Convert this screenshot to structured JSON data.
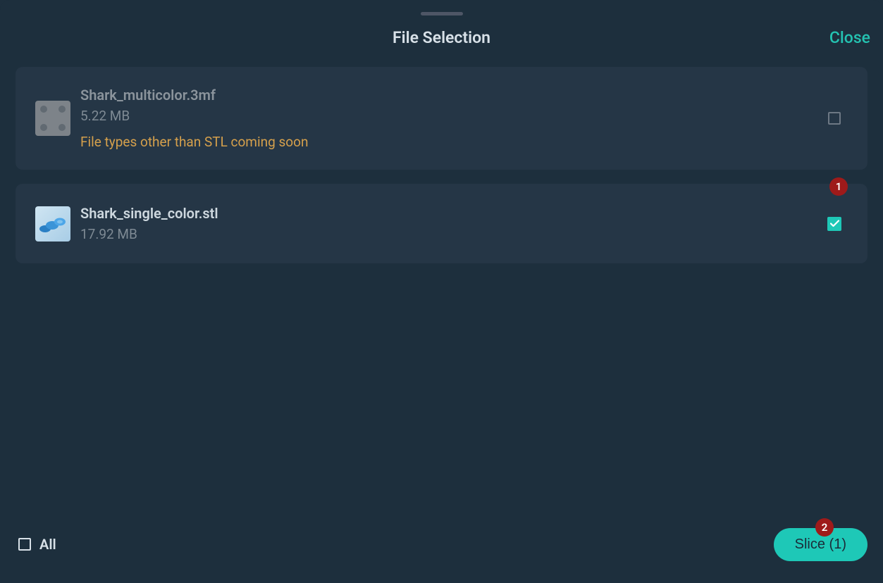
{
  "header": {
    "title": "File Selection",
    "close": "Close"
  },
  "files": [
    {
      "name": "Shark_multicolor.3mf",
      "size": "5.22 MB",
      "warning": "File types other than STL coming soon",
      "selected": false,
      "disabled": true
    },
    {
      "name": "Shark_single_color.stl",
      "size": "17.92 MB",
      "selected": true,
      "disabled": false
    }
  ],
  "badges": {
    "row1": "1",
    "slice": "2"
  },
  "footer": {
    "all": "All",
    "slice_label": "Slice (1)"
  },
  "colors": {
    "accent": "#1ec8b7",
    "bg": "#1d2f3d",
    "row": "#253646",
    "warn": "#d5a04c",
    "badge": "#9e1a1a"
  }
}
